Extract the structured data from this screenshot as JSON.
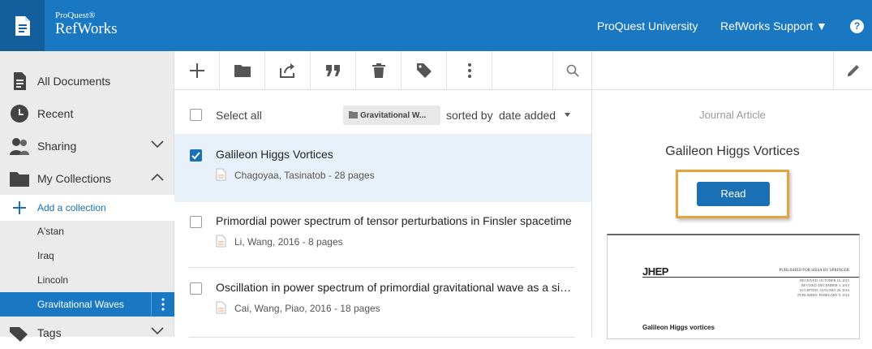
{
  "header": {
    "brand_small": "ProQuest®",
    "brand_big": "RefWorks",
    "links": [
      {
        "label": "ProQuest University"
      },
      {
        "label": "RefWorks Support ▼"
      }
    ],
    "help": "?"
  },
  "sidebar": {
    "items": [
      {
        "label": "All Documents",
        "icon": "document-icon"
      },
      {
        "label": "Recent",
        "icon": "clock-icon"
      },
      {
        "label": "Sharing",
        "icon": "people-icon"
      },
      {
        "label": "My Collections",
        "icon": "folder-icon"
      }
    ],
    "add_collection": "Add a collection",
    "collections": [
      "A'stan",
      "Iraq",
      "Lincoln",
      "Gravitational Waves"
    ],
    "tags_label": "Tags"
  },
  "list": {
    "select_all": "Select all",
    "collection_chip": "Gravitational W...",
    "sorted_by": "sorted by",
    "sort_value": "date added",
    "rows": [
      {
        "title": "Galileon Higgs Vortices",
        "meta": "Chagoyaa, Tasinatob - 28 pages",
        "checked": true
      },
      {
        "title": "Primordial power spectrum of tensor perturbations in Finsler spacetime",
        "meta": "Li, Wang, 2016 - 8 pages",
        "checked": false
      },
      {
        "title": "Oscillation in power spectrum of primordial gravitational wave as a signal",
        "meta": "Cai, Wang, Piao, 2016 - 18 pages",
        "checked": false
      }
    ]
  },
  "detail": {
    "type": "Journal Article",
    "title": "Galileon Higgs Vortices",
    "read_label": "Read",
    "preview": {
      "logo": "JHEP",
      "publisher": "Published for SISSA by Springer",
      "dates": [
        "Received: October 16, 2015",
        "Revised: December 3, 2015",
        "Accepted: January 26, 2016",
        "Published: February 9, 2016"
      ],
      "heading": "Galileon Higgs vortices"
    }
  },
  "colors": {
    "brand": "#1a78c2",
    "highlight": "#e6a23c"
  }
}
